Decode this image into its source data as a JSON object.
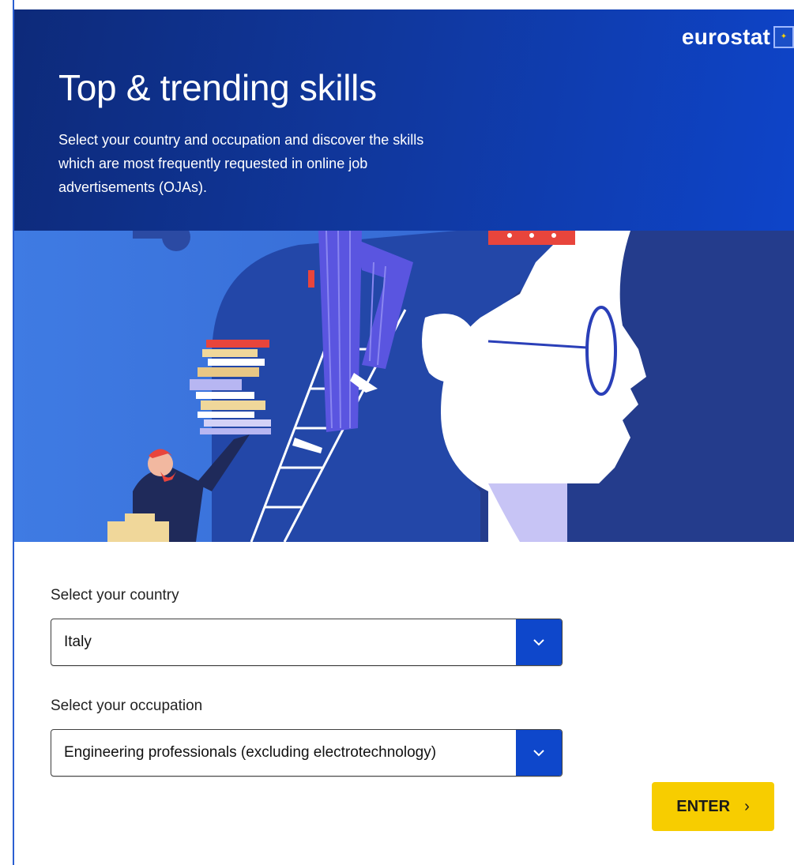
{
  "header": {
    "brand": "eurostat",
    "title": "Top & trending skills",
    "intro": "Select your country and occupation and discover the skills which are most frequently requested in online job advertisements (OJAs)."
  },
  "form": {
    "country_label": "Select your country",
    "country_value": "Italy",
    "occupation_label": "Select your occupation",
    "occupation_value": "Engineering professionals (excluding electrotechnology)",
    "enter_label": "ENTER",
    "enter_icon": "chevron-right-icon",
    "dropdown_icon": "chevron-down-icon"
  },
  "colors": {
    "header_dark": "#0d2a7a",
    "header_bright": "#0e44c9",
    "select_accent": "#0e47cb",
    "button_yellow": "#f7cd00",
    "hero_background": "#3a72dd"
  }
}
